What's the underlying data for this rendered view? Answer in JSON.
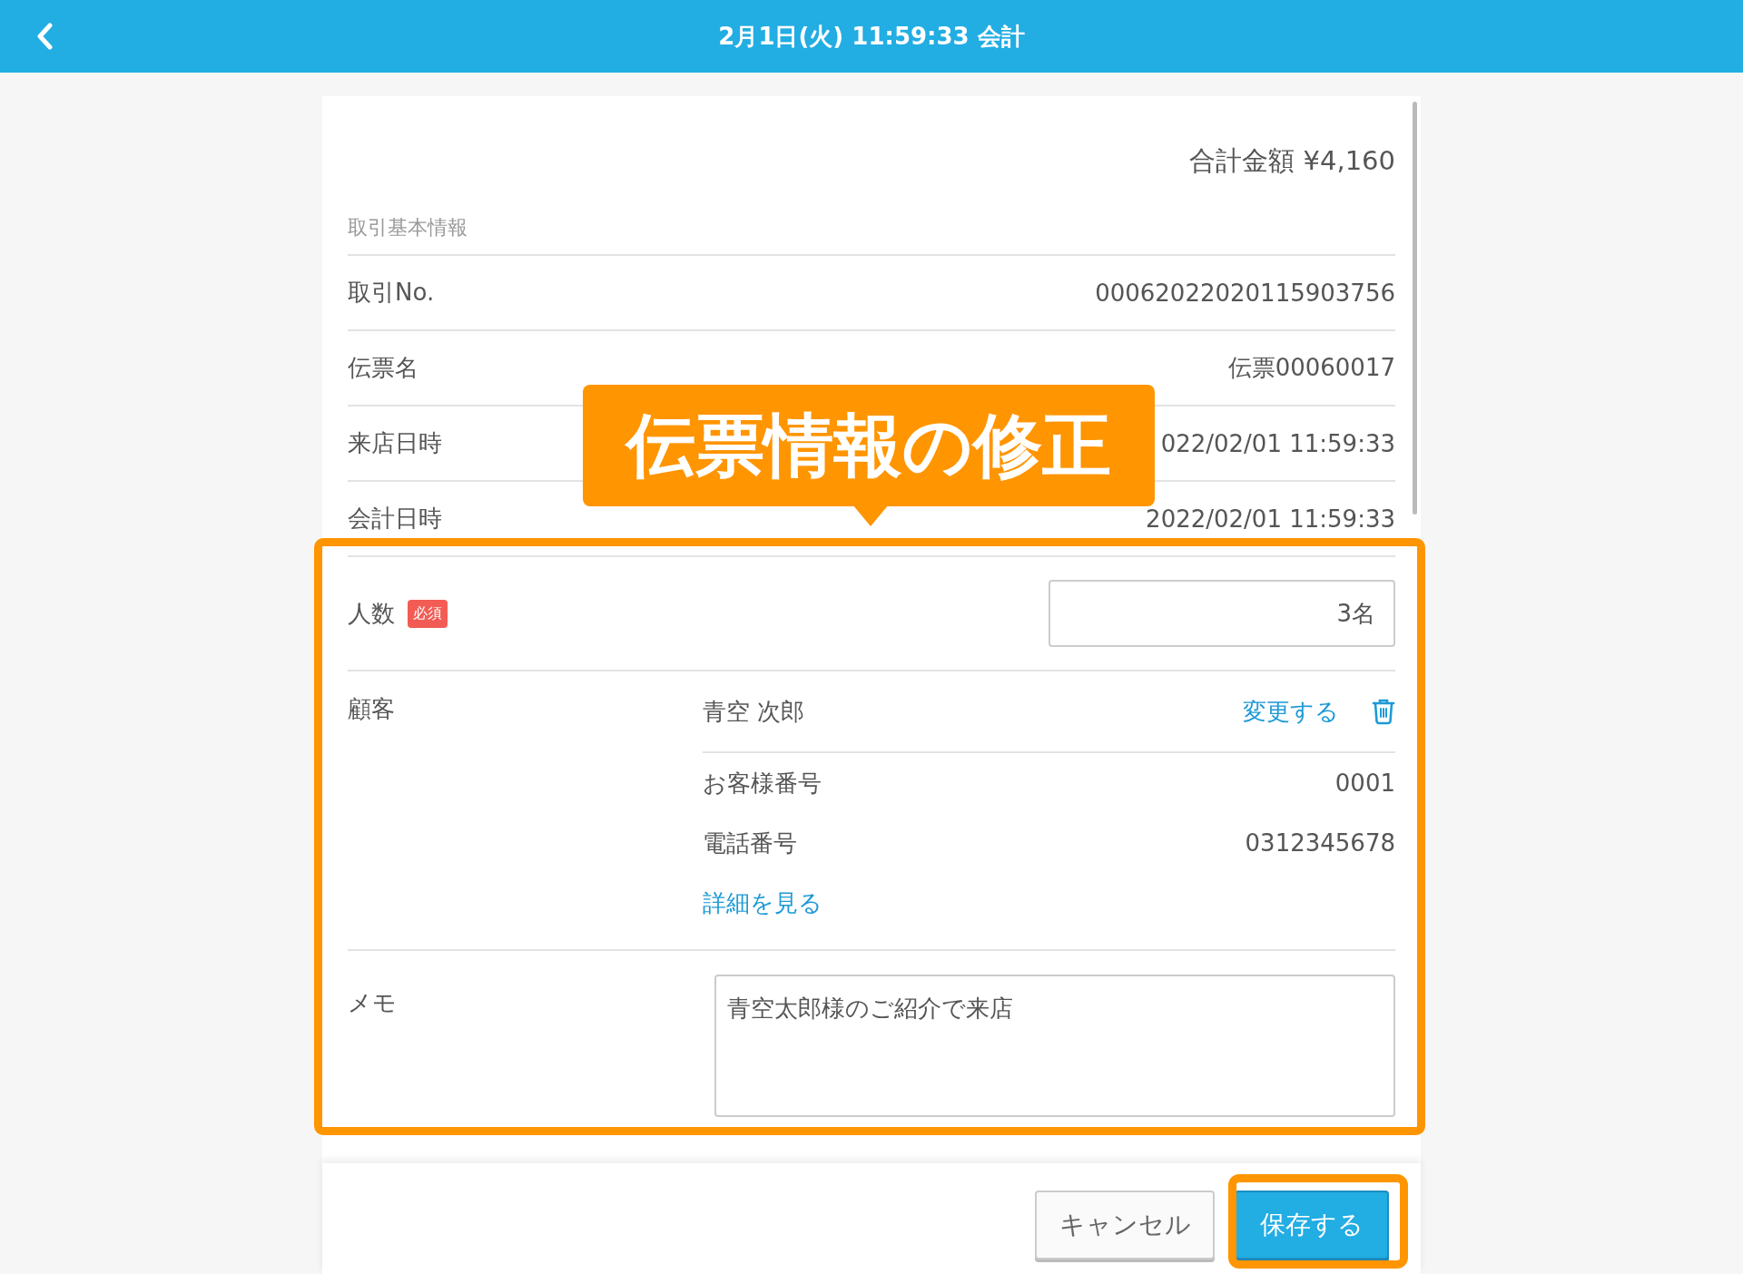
{
  "header": {
    "title": "2月1日(火) 11:59:33 会計"
  },
  "total": "合計金額 ¥4,160",
  "section_label": "取引基本情報",
  "info_rows": [
    {
      "label": "取引No.",
      "value": "00062022020115903756"
    },
    {
      "label": "伝票名",
      "value": "伝票00060017"
    },
    {
      "label": "来店日時",
      "value": "022/02/01 11:59:33"
    },
    {
      "label": "会計日時",
      "value": "2022/02/01 11:59:33"
    }
  ],
  "guests": {
    "label": "人数",
    "badge": "必須",
    "value": "3名"
  },
  "customer": {
    "label": "顧客",
    "name": "青空 次郎",
    "change_link": "変更する",
    "details": [
      {
        "label": "お客様番号",
        "value": "0001"
      },
      {
        "label": "電話番号",
        "value": "0312345678"
      }
    ],
    "detail_link": "詳細を見る"
  },
  "memo": {
    "label": "メモ",
    "value": "青空太郎様のご紹介で来店"
  },
  "callout": "伝票情報の修正",
  "buttons": [
    {
      "label": "キャンセル",
      "kind": "secondary"
    },
    {
      "label": "保存する",
      "kind": "primary"
    }
  ]
}
